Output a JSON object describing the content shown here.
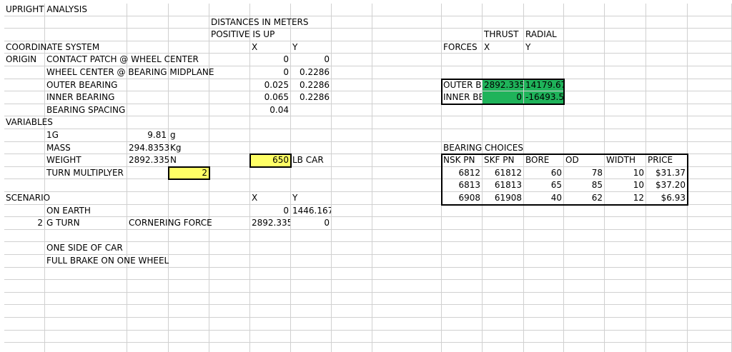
{
  "sheet": {
    "cells": [
      {
        "r": 0,
        "c": 0,
        "t": "UPRIGHT ANALYSIS"
      },
      {
        "r": 1,
        "c": 4,
        "t": "DISTANCES IN METERS"
      },
      {
        "r": 2,
        "c": 4,
        "t": "POSITIVE IS UP"
      },
      {
        "r": 2,
        "c": 10,
        "t": "THRUST"
      },
      {
        "r": 2,
        "c": 11,
        "t": "RADIAL"
      },
      {
        "r": 3,
        "c": 0,
        "t": "COORDINATE SYSTEM"
      },
      {
        "r": 3,
        "c": 5,
        "t": "X"
      },
      {
        "r": 3,
        "c": 6,
        "t": "Y"
      },
      {
        "r": 3,
        "c": 9,
        "t": "FORCES"
      },
      {
        "r": 3,
        "c": 10,
        "t": "X"
      },
      {
        "r": 3,
        "c": 11,
        "t": "Y"
      },
      {
        "r": 4,
        "c": 0,
        "t": "ORIGIN"
      },
      {
        "r": 4,
        "c": 1,
        "t": "CONTACT PATCH @ WHEEL CENTER"
      },
      {
        "r": 4,
        "c": 5,
        "t": "0",
        "a": "r"
      },
      {
        "r": 4,
        "c": 6,
        "t": "0",
        "a": "r"
      },
      {
        "r": 5,
        "c": 1,
        "t": "WHEEL CENTER @ BEARING MIDPLANE",
        "clip": true,
        "span": 4
      },
      {
        "r": 5,
        "c": 5,
        "t": "0",
        "a": "r"
      },
      {
        "r": 5,
        "c": 6,
        "t": "0.2286",
        "a": "r"
      },
      {
        "r": 6,
        "c": 1,
        "t": "OUTER BEARING"
      },
      {
        "r": 6,
        "c": 5,
        "t": "0.025",
        "a": "r"
      },
      {
        "r": 6,
        "c": 6,
        "t": "0.2286",
        "a": "r"
      },
      {
        "r": 6,
        "c": 9,
        "t": "OUTER BEARING",
        "clip": true
      },
      {
        "r": 6,
        "c": 10,
        "t": "2892.335",
        "clip": true,
        "fill": "g"
      },
      {
        "r": 6,
        "c": 11,
        "t": "14179.67",
        "clip": true,
        "fill": "g"
      },
      {
        "r": 7,
        "c": 1,
        "t": "INNER BEARING"
      },
      {
        "r": 7,
        "c": 5,
        "t": "0.065",
        "a": "r"
      },
      {
        "r": 7,
        "c": 6,
        "t": "0.2286",
        "a": "r"
      },
      {
        "r": 7,
        "c": 9,
        "t": "INNER BEARING",
        "clip": true
      },
      {
        "r": 7,
        "c": 10,
        "t": "0",
        "a": "r",
        "fill": "g"
      },
      {
        "r": 7,
        "c": 11,
        "t": "-16493.5",
        "clip": true,
        "fill": "g"
      },
      {
        "r": 8,
        "c": 1,
        "t": "BEARING SPACING"
      },
      {
        "r": 8,
        "c": 5,
        "t": "0.04",
        "a": "r"
      },
      {
        "r": 9,
        "c": 0,
        "t": "VARIABLES"
      },
      {
        "r": 10,
        "c": 1,
        "t": "1G"
      },
      {
        "r": 10,
        "c": 2,
        "t": "9.81",
        "a": "r"
      },
      {
        "r": 10,
        "c": 3,
        "t": "g"
      },
      {
        "r": 11,
        "c": 1,
        "t": "MASS"
      },
      {
        "r": 11,
        "c": 2,
        "t": "294.8353",
        "a": "r"
      },
      {
        "r": 11,
        "c": 3,
        "t": "Kg"
      },
      {
        "r": 11,
        "c": 9,
        "t": "BEARING CHOICES"
      },
      {
        "r": 12,
        "c": 1,
        "t": "WEIGHT"
      },
      {
        "r": 12,
        "c": 2,
        "t": "2892.335",
        "a": "r"
      },
      {
        "r": 12,
        "c": 3,
        "t": "N"
      },
      {
        "r": 12,
        "c": 5,
        "t": "650",
        "a": "r",
        "fill": "y"
      },
      {
        "r": 12,
        "c": 6,
        "t": "LB CAR"
      },
      {
        "r": 12,
        "c": 9,
        "t": "NSK PN"
      },
      {
        "r": 12,
        "c": 10,
        "t": "SKF PN"
      },
      {
        "r": 12,
        "c": 11,
        "t": "BORE"
      },
      {
        "r": 12,
        "c": 12,
        "t": "OD"
      },
      {
        "r": 12,
        "c": 13,
        "t": "WIDTH"
      },
      {
        "r": 12,
        "c": 14,
        "t": "PRICE"
      },
      {
        "r": 13,
        "c": 1,
        "t": "TURN MULTIPLYER"
      },
      {
        "r": 13,
        "c": 3,
        "t": "2",
        "a": "r",
        "fill": "y"
      },
      {
        "r": 13,
        "c": 9,
        "t": "6812",
        "a": "r"
      },
      {
        "r": 13,
        "c": 10,
        "t": "61812",
        "a": "r"
      },
      {
        "r": 13,
        "c": 11,
        "t": "60",
        "a": "r"
      },
      {
        "r": 13,
        "c": 12,
        "t": "78",
        "a": "r"
      },
      {
        "r": 13,
        "c": 13,
        "t": "10",
        "a": "r"
      },
      {
        "r": 13,
        "c": 14,
        "t": "$31.37",
        "a": "r"
      },
      {
        "r": 14,
        "c": 9,
        "t": "6813",
        "a": "r"
      },
      {
        "r": 14,
        "c": 10,
        "t": "61813",
        "a": "r"
      },
      {
        "r": 14,
        "c": 11,
        "t": "65",
        "a": "r"
      },
      {
        "r": 14,
        "c": 12,
        "t": "85",
        "a": "r"
      },
      {
        "r": 14,
        "c": 13,
        "t": "10",
        "a": "r"
      },
      {
        "r": 14,
        "c": 14,
        "t": "$37.20",
        "a": "r"
      },
      {
        "r": 15,
        "c": 0,
        "t": "SCENARIO"
      },
      {
        "r": 15,
        "c": 5,
        "t": "X"
      },
      {
        "r": 15,
        "c": 6,
        "t": "Y"
      },
      {
        "r": 15,
        "c": 9,
        "t": "6908",
        "a": "r"
      },
      {
        "r": 15,
        "c": 10,
        "t": "61908",
        "a": "r"
      },
      {
        "r": 15,
        "c": 11,
        "t": "40",
        "a": "r"
      },
      {
        "r": 15,
        "c": 12,
        "t": "62",
        "a": "r"
      },
      {
        "r": 15,
        "c": 13,
        "t": "12",
        "a": "r"
      },
      {
        "r": 15,
        "c": 14,
        "t": "$6.93",
        "a": "r"
      },
      {
        "r": 16,
        "c": 1,
        "t": "ON EARTH"
      },
      {
        "r": 16,
        "c": 5,
        "t": "0",
        "a": "r"
      },
      {
        "r": 16,
        "c": 6,
        "t": "1446.167",
        "clip": true
      },
      {
        "r": 17,
        "c": 0,
        "t": "2",
        "a": "r"
      },
      {
        "r": 17,
        "c": 1,
        "t": "G TURN"
      },
      {
        "r": 17,
        "c": 2,
        "t": "CORNERING FORCE"
      },
      {
        "r": 17,
        "c": 5,
        "t": "2892.335",
        "clip": true
      },
      {
        "r": 17,
        "c": 6,
        "t": "0",
        "a": "r"
      },
      {
        "r": 19,
        "c": 1,
        "t": "ONE SIDE OF CAR"
      },
      {
        "r": 20,
        "c": 1,
        "t": "FULL BRAKE ON ONE WHEEL"
      }
    ]
  }
}
